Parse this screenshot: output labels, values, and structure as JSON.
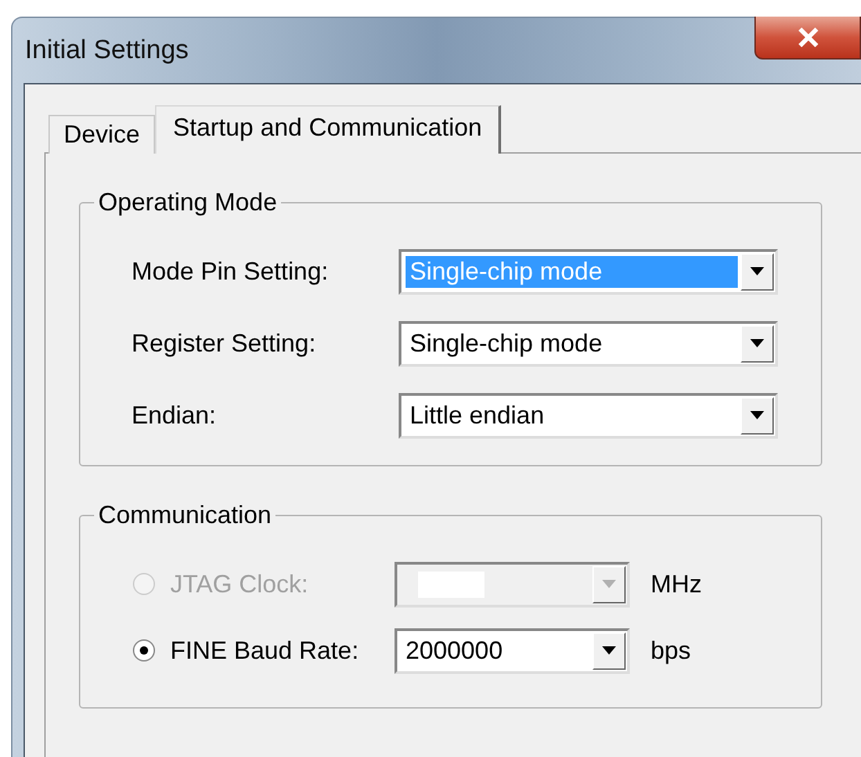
{
  "window": {
    "title": "Initial Settings"
  },
  "tabs": [
    {
      "label": "Device",
      "selected": false
    },
    {
      "label": "Startup and Communication",
      "selected": true
    }
  ],
  "operating_mode": {
    "title": "Operating Mode",
    "fields": [
      {
        "label": "Mode Pin Setting:",
        "value": "Single-chip mode",
        "focused": true
      },
      {
        "label": "Register Setting:",
        "value": "Single-chip mode",
        "focused": false
      },
      {
        "label": "Endian:",
        "value": "Little endian",
        "focused": false
      }
    ]
  },
  "communication": {
    "title": "Communication",
    "options": [
      {
        "label": "JTAG Clock:",
        "selected": false,
        "disabled": true,
        "unit": "MHz"
      },
      {
        "label": "FINE Baud Rate:",
        "selected": true,
        "disabled": false,
        "value": "2000000",
        "unit": "bps"
      }
    ]
  }
}
